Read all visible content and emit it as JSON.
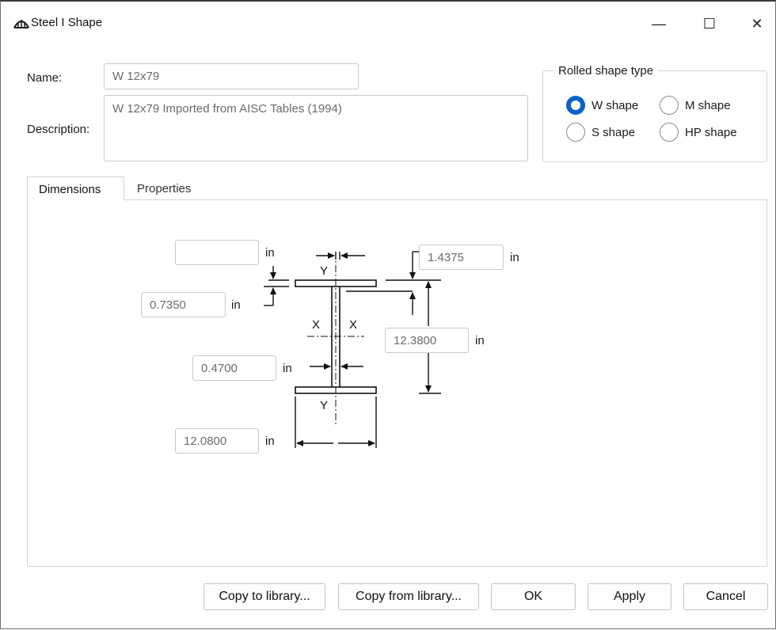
{
  "window": {
    "title": "Steel I Shape",
    "app_icon": "bridge-icon",
    "controls": {
      "minimize": "—",
      "maximize": "☐",
      "close": "✕"
    }
  },
  "form": {
    "name_label": "Name:",
    "name_value": "W 12x79",
    "description_label": "Description:",
    "description_value": "W 12x79 Imported from AISC Tables (1994)"
  },
  "shape_type": {
    "title": "Rolled shape type",
    "options": [
      {
        "label": "W shape",
        "checked": true
      },
      {
        "label": "M shape",
        "checked": false
      },
      {
        "label": "S shape",
        "checked": false
      },
      {
        "label": "HP shape",
        "checked": false
      }
    ]
  },
  "tabs": [
    {
      "label": "Dimensions",
      "active": true
    },
    {
      "label": "Properties",
      "active": false
    }
  ],
  "dimensions": {
    "top_flange_width": "",
    "top_flange_thickness": "0.7350",
    "web_thickness": "0.4700",
    "bottom_flange_width": "12.0800",
    "k_distance": "1.4375",
    "depth": "12.3800",
    "unit": "in"
  },
  "diagram": {
    "axis_y_top": "Y",
    "axis_y_bottom": "Y",
    "axis_x_left": "X",
    "axis_x_right": "X"
  },
  "buttons": {
    "copy_to": "Copy to library...",
    "copy_from": "Copy from library...",
    "ok": "OK",
    "apply": "Apply",
    "cancel": "Cancel"
  },
  "colors": {
    "accent": "#0a64c8",
    "border": "#d3d3d3",
    "field_text": "#6b6b6b"
  }
}
